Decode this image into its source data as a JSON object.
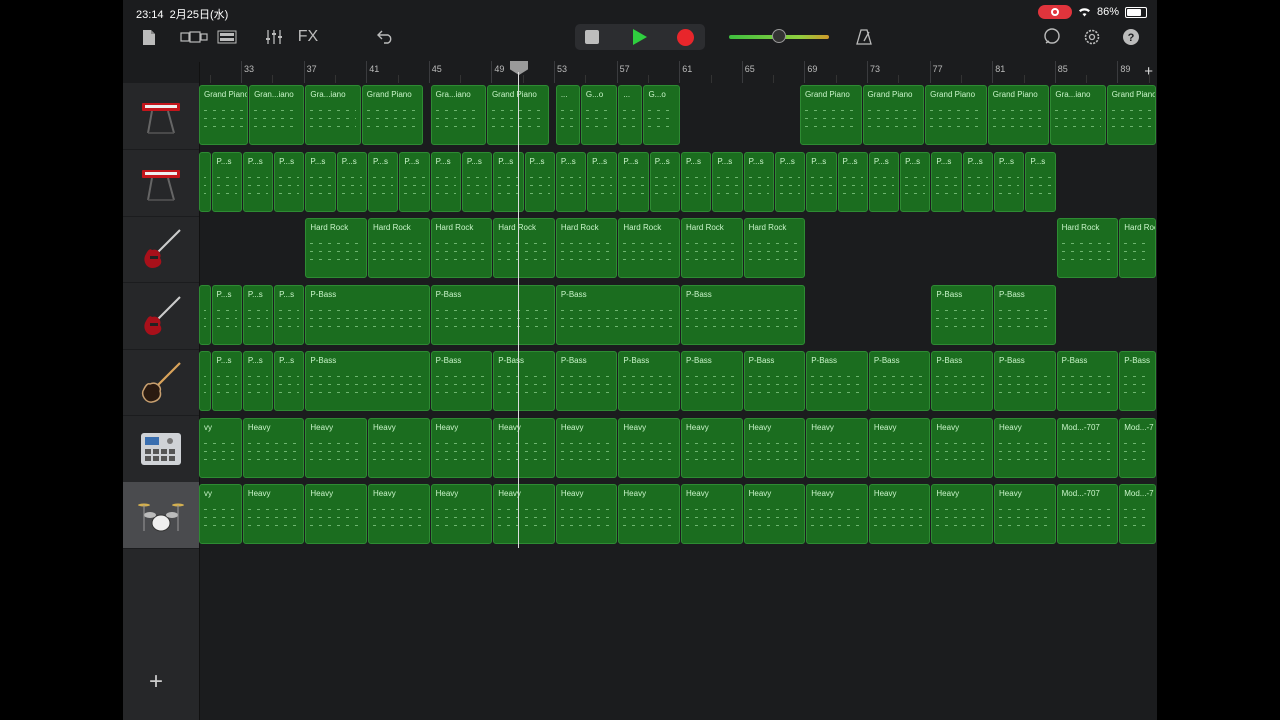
{
  "status": {
    "time": "23:14",
    "date": "2月25日(水)",
    "battery": "86%"
  },
  "toolbar": {
    "left_icons": [
      "document-icon",
      "view-toggle-icon",
      "track-view-icon",
      "mixer-icon"
    ],
    "fx_label": "FX",
    "right_icons": [
      "loop-icon",
      "settings-icon",
      "help-icon"
    ],
    "volume_level": 0.5
  },
  "ruler": {
    "bars": [
      "33",
      "37",
      "41",
      "45",
      "49",
      "53",
      "57",
      "61",
      "65",
      "69",
      "73",
      "77",
      "81",
      "85",
      "89"
    ]
  },
  "tracks": [
    {
      "name": "keyboard-1",
      "icon": "keyboard-icon",
      "regions": [
        {
          "label": "Grand Piano",
          "start": 0,
          "end": 0.8
        },
        {
          "label": "Gran...iano",
          "start": 0.8,
          "end": 1.7
        },
        {
          "label": "Gra...iano",
          "start": 1.7,
          "end": 2.6
        },
        {
          "label": "Grand Piano",
          "start": 2.6,
          "end": 3.6
        },
        {
          "label": "Gra...iano",
          "start": 3.7,
          "end": 4.6
        },
        {
          "label": "Grand Piano",
          "start": 4.6,
          "end": 5.6
        },
        {
          "label": "...",
          "start": 5.7,
          "end": 6.1
        },
        {
          "label": "G...o",
          "start": 6.1,
          "end": 6.7
        },
        {
          "label": "...",
          "start": 6.7,
          "end": 7.1
        },
        {
          "label": "G...o",
          "start": 7.1,
          "end": 7.7
        },
        {
          "label": "Grand Piano",
          "start": 9.6,
          "end": 10.6
        },
        {
          "label": "Grand Piano",
          "start": 10.6,
          "end": 11.6
        },
        {
          "label": "Grand Piano",
          "start": 11.6,
          "end": 12.6
        },
        {
          "label": "Grand Piano",
          "start": 12.6,
          "end": 13.6
        },
        {
          "label": "Gra...iano",
          "start": 13.6,
          "end": 14.5
        },
        {
          "label": "Grand Piano",
          "start": 14.5,
          "end": 15.4
        }
      ]
    },
    {
      "name": "keyboard-2",
      "icon": "keyboard-icon",
      "regions": [
        {
          "label": "",
          "start": 0,
          "end": 0.2
        },
        {
          "label": "P...s",
          "start": 0.2,
          "end": 0.7
        },
        {
          "label": "P...s",
          "start": 0.7,
          "end": 1.2
        },
        {
          "label": "P...s",
          "start": 1.2,
          "end": 1.7
        },
        {
          "label": "P...s",
          "start": 1.7,
          "end": 2.2
        },
        {
          "label": "P...s",
          "start": 2.2,
          "end": 2.7
        },
        {
          "label": "P...s",
          "start": 2.7,
          "end": 3.2
        },
        {
          "label": "P...s",
          "start": 3.2,
          "end": 3.7
        },
        {
          "label": "P...s",
          "start": 3.7,
          "end": 4.2
        },
        {
          "label": "P...s",
          "start": 4.2,
          "end": 4.7
        },
        {
          "label": "P...s",
          "start": 4.7,
          "end": 5.2
        },
        {
          "label": "P...s",
          "start": 5.2,
          "end": 5.7
        },
        {
          "label": "P...s",
          "start": 5.7,
          "end": 6.2
        },
        {
          "label": "P...s",
          "start": 6.2,
          "end": 6.7
        },
        {
          "label": "P...s",
          "start": 6.7,
          "end": 7.2
        },
        {
          "label": "P...s",
          "start": 7.2,
          "end": 7.7
        },
        {
          "label": "P...s",
          "start": 7.7,
          "end": 8.2
        },
        {
          "label": "P...s",
          "start": 8.2,
          "end": 8.7
        },
        {
          "label": "P...s",
          "start": 8.7,
          "end": 9.2
        },
        {
          "label": "P...s",
          "start": 9.2,
          "end": 9.7
        },
        {
          "label": "P...s",
          "start": 9.7,
          "end": 10.2
        },
        {
          "label": "P...s",
          "start": 10.2,
          "end": 10.7
        },
        {
          "label": "P...s",
          "start": 10.7,
          "end": 11.2
        },
        {
          "label": "P...s",
          "start": 11.2,
          "end": 11.7
        },
        {
          "label": "P...s",
          "start": 11.7,
          "end": 12.2
        },
        {
          "label": "P...s",
          "start": 12.2,
          "end": 12.7
        },
        {
          "label": "P...s",
          "start": 12.7,
          "end": 13.2
        },
        {
          "label": "P...s",
          "start": 13.2,
          "end": 13.7
        }
      ]
    },
    {
      "name": "electric-guitar-1",
      "icon": "guitar-icon",
      "regions": [
        {
          "label": "Hard Rock",
          "start": 1.7,
          "end": 2.7
        },
        {
          "label": "Hard Rock",
          "start": 2.7,
          "end": 3.7
        },
        {
          "label": "Hard Rock",
          "start": 3.7,
          "end": 4.7
        },
        {
          "label": "Hard Rock",
          "start": 4.7,
          "end": 5.7
        },
        {
          "label": "Hard Rock",
          "start": 5.7,
          "end": 6.7
        },
        {
          "label": "Hard Rock",
          "start": 6.7,
          "end": 7.7
        },
        {
          "label": "Hard Rock",
          "start": 7.7,
          "end": 8.7
        },
        {
          "label": "Hard Rock",
          "start": 8.7,
          "end": 9.7
        },
        {
          "label": "Hard Rock",
          "start": 13.7,
          "end": 14.7
        },
        {
          "label": "Hard Rock",
          "start": 14.7,
          "end": 15.4
        }
      ]
    },
    {
      "name": "electric-guitar-2",
      "icon": "guitar-icon",
      "regions": [
        {
          "label": "",
          "start": 0,
          "end": 0.2
        },
        {
          "label": "P...s",
          "start": 0.2,
          "end": 0.7
        },
        {
          "label": "P...s",
          "start": 0.7,
          "end": 1.2
        },
        {
          "label": "P...s",
          "start": 1.2,
          "end": 1.7
        },
        {
          "label": "P-Bass",
          "start": 1.7,
          "end": 3.7
        },
        {
          "label": "P-Bass",
          "start": 3.7,
          "end": 5.7
        },
        {
          "label": "P-Bass",
          "start": 5.7,
          "end": 7.7
        },
        {
          "label": "P-Bass",
          "start": 7.7,
          "end": 9.7
        },
        {
          "label": "P-Bass",
          "start": 11.7,
          "end": 12.7
        },
        {
          "label": "P-Bass",
          "start": 12.7,
          "end": 13.7
        }
      ]
    },
    {
      "name": "bass-guitar",
      "icon": "bass-icon",
      "regions": [
        {
          "label": "",
          "start": 0,
          "end": 0.2
        },
        {
          "label": "P...s",
          "start": 0.2,
          "end": 0.7
        },
        {
          "label": "P...s",
          "start": 0.7,
          "end": 1.2
        },
        {
          "label": "P...s",
          "start": 1.2,
          "end": 1.7
        },
        {
          "label": "P-Bass",
          "start": 1.7,
          "end": 3.7
        },
        {
          "label": "P-Bass",
          "start": 3.7,
          "end": 4.7
        },
        {
          "label": "P-Bass",
          "start": 4.7,
          "end": 5.7
        },
        {
          "label": "P-Bass",
          "start": 5.7,
          "end": 6.7
        },
        {
          "label": "P-Bass",
          "start": 6.7,
          "end": 7.7
        },
        {
          "label": "P-Bass",
          "start": 7.7,
          "end": 8.7
        },
        {
          "label": "P-Bass",
          "start": 8.7,
          "end": 9.7
        },
        {
          "label": "P-Bass",
          "start": 9.7,
          "end": 10.7
        },
        {
          "label": "P-Bass",
          "start": 10.7,
          "end": 11.7
        },
        {
          "label": "P-Bass",
          "start": 11.7,
          "end": 12.7
        },
        {
          "label": "P-Bass",
          "start": 12.7,
          "end": 13.7
        },
        {
          "label": "P-Bass",
          "start": 13.7,
          "end": 14.7
        },
        {
          "label": "P-Bass",
          "start": 14.7,
          "end": 15.4
        }
      ]
    },
    {
      "name": "beat-sequencer",
      "icon": "drum-machine-icon",
      "regions": [
        {
          "label": "vy",
          "start": 0,
          "end": 0.7
        },
        {
          "label": "Heavy",
          "start": 0.7,
          "end": 1.7
        },
        {
          "label": "Heavy",
          "start": 1.7,
          "end": 2.7
        },
        {
          "label": "Heavy",
          "start": 2.7,
          "end": 3.7
        },
        {
          "label": "Heavy",
          "start": 3.7,
          "end": 4.7
        },
        {
          "label": "Heavy",
          "start": 4.7,
          "end": 5.7
        },
        {
          "label": "Heavy",
          "start": 5.7,
          "end": 6.7
        },
        {
          "label": "Heavy",
          "start": 6.7,
          "end": 7.7
        },
        {
          "label": "Heavy",
          "start": 7.7,
          "end": 8.7
        },
        {
          "label": "Heavy",
          "start": 8.7,
          "end": 9.7
        },
        {
          "label": "Heavy",
          "start": 9.7,
          "end": 10.7
        },
        {
          "label": "Heavy",
          "start": 10.7,
          "end": 11.7
        },
        {
          "label": "Heavy",
          "start": 11.7,
          "end": 12.7
        },
        {
          "label": "Heavy",
          "start": 12.7,
          "end": 13.7
        },
        {
          "label": "Mod...-707",
          "start": 13.7,
          "end": 14.7
        },
        {
          "label": "Mod...-7",
          "start": 14.7,
          "end": 15.4
        }
      ]
    },
    {
      "name": "drum-kit",
      "icon": "drum-kit-icon",
      "selected": true,
      "regions": [
        {
          "label": "vy",
          "start": 0,
          "end": 0.7
        },
        {
          "label": "Heavy",
          "start": 0.7,
          "end": 1.7
        },
        {
          "label": "Heavy",
          "start": 1.7,
          "end": 2.7
        },
        {
          "label": "Heavy",
          "start": 2.7,
          "end": 3.7
        },
        {
          "label": "Heavy",
          "start": 3.7,
          "end": 4.7
        },
        {
          "label": "Heavy",
          "start": 4.7,
          "end": 5.7
        },
        {
          "label": "Heavy",
          "start": 5.7,
          "end": 6.7
        },
        {
          "label": "Heavy",
          "start": 6.7,
          "end": 7.7
        },
        {
          "label": "Heavy",
          "start": 7.7,
          "end": 8.7
        },
        {
          "label": "Heavy",
          "start": 8.7,
          "end": 9.7
        },
        {
          "label": "Heavy",
          "start": 9.7,
          "end": 10.7
        },
        {
          "label": "Heavy",
          "start": 10.7,
          "end": 11.7
        },
        {
          "label": "Heavy",
          "start": 11.7,
          "end": 12.7
        },
        {
          "label": "Heavy",
          "start": 12.7,
          "end": 13.7
        },
        {
          "label": "Mod...-707",
          "start": 13.7,
          "end": 14.7
        },
        {
          "label": "Mod...-7",
          "start": 14.7,
          "end": 15.4
        }
      ]
    }
  ],
  "colors": {
    "region_fill": "#1b6d1f",
    "region_border": "#2e8b33",
    "play": "#2fcf3f",
    "record": "#e8262b"
  }
}
